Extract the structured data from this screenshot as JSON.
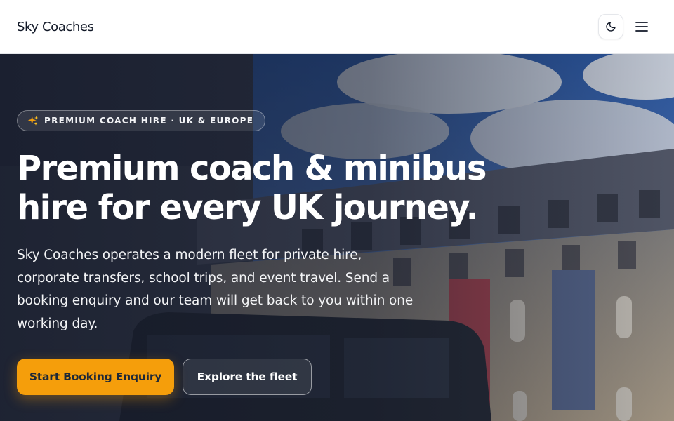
{
  "header": {
    "brand": "Sky Coaches",
    "theme_toggle_icon": "moon-icon",
    "menu_icon": "hamburger-menu-icon"
  },
  "hero": {
    "background": "photo of a coach parked beside an ornate stone building under a cloudy blue sky",
    "badge": {
      "icon": "sparkle-icon",
      "text": "PREMIUM COACH HIRE · UK & EUROPE"
    },
    "headline_line1": "Premium coach & minibus",
    "headline_line2": "hire for every UK journey.",
    "subtext": "Sky Coaches operates a modern fleet for private hire, corporate transfers, school trips, and event travel. Send a booking enquiry and our team will get back to you within one working day.",
    "primary_cta": "Start Booking Enquiry",
    "secondary_cta": "Explore the fleet"
  },
  "colors": {
    "accent": "#f59e0b",
    "header_bg": "#ffffff",
    "brand_text": "#111827",
    "hero_text": "#ffffff"
  }
}
